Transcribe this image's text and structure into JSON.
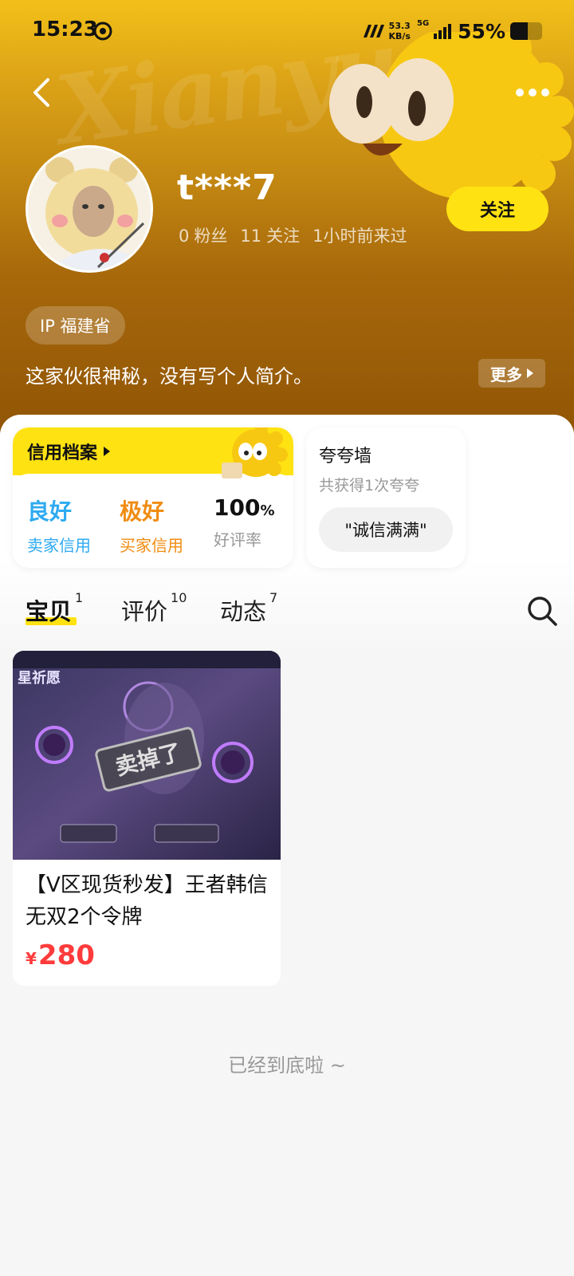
{
  "status_bar": {
    "time": "15:23",
    "net_speed_value": "53.3",
    "net_speed_unit": "KB/s",
    "signal_type": "5G",
    "battery_percent": "55%",
    "battery_level": 0.55
  },
  "profile": {
    "username": "t***7",
    "fans_count": "0",
    "fans_label": "粉丝",
    "following_count": "11",
    "following_label": "关注",
    "last_active": "1小时前来过",
    "follow_button": "关注",
    "ip_location": "IP 福建省",
    "bio": "这家伙很神秘，没有写个人简介。",
    "more_label": "更多"
  },
  "credit": {
    "title": "信用档案",
    "items": [
      {
        "value": "良好",
        "label": "卖家信用",
        "color": "#2eaaf0"
      },
      {
        "value": "极好",
        "label": "买家信用",
        "color": "#f08c12"
      },
      {
        "value": "100",
        "unit": "%",
        "label": "好评率",
        "color": "#111111"
      }
    ]
  },
  "praise_wall": {
    "title": "夸夸墙",
    "subtitle": "共获得1次夸夸",
    "tag": "\"诚信满满\""
  },
  "tabs": [
    {
      "label": "宝贝",
      "count": "1",
      "active": true
    },
    {
      "label": "评价",
      "count": "10",
      "active": false
    },
    {
      "label": "动态",
      "count": "7",
      "active": false
    }
  ],
  "product": {
    "title": "【V区现货秒发】王者韩信无双2个令牌",
    "currency": "¥",
    "price": "280",
    "sold_stamp": "卖掉了",
    "image_text": "星祈愿"
  },
  "footer": {
    "end_text": "已经到底啦 ~"
  },
  "colors": {
    "accent_yellow": "#ffe212",
    "price_red": "#ff3b3b"
  }
}
